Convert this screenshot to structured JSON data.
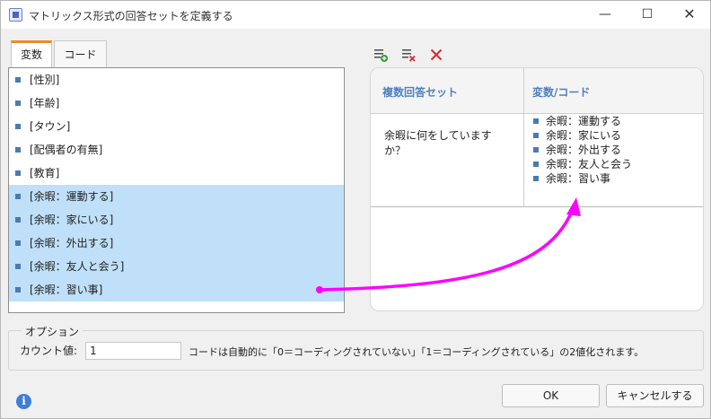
{
  "window": {
    "title": "マトリックス形式の回答セットを定義する",
    "minimize_glyph": "—",
    "maximize_glyph": "☐",
    "close_glyph": "✕"
  },
  "tabs": [
    {
      "label": "変数",
      "active": true
    },
    {
      "label": "コード",
      "active": false
    }
  ],
  "variables": [
    {
      "label": "[性別]",
      "selected": false
    },
    {
      "label": "[年齢]",
      "selected": false
    },
    {
      "label": "[タウン]",
      "selected": false
    },
    {
      "label": "[配偶者の有無]",
      "selected": false
    },
    {
      "label": "[教育]",
      "selected": false
    },
    {
      "label": "[余暇：運動する]",
      "selected": true
    },
    {
      "label": "[余暇：家にいる]",
      "selected": true
    },
    {
      "label": "[余暇：外出する]",
      "selected": true
    },
    {
      "label": "[余暇：友人と会う]",
      "selected": true
    },
    {
      "label": "[余暇：習い事]",
      "selected": true
    }
  ],
  "toolbar": {
    "icons": [
      "add-set-icon",
      "remove-set-icon",
      "delete-icon"
    ],
    "accent_green": "#3a9a3a",
    "accent_red": "#d62b2b"
  },
  "grid": {
    "col1_header": "複数回答セット",
    "col2_header": "変数/コード",
    "question": "余暇に何をしていますか？",
    "items": [
      "余暇：運動する",
      "余暇：家にいる",
      "余暇：外出する",
      "余暇：友人と会う",
      "余暇：習い事"
    ]
  },
  "options": {
    "group_label": "オプション",
    "count_label": "カウント値:",
    "count_value": "1",
    "note": "コードは自動的に「0＝コーディングされていない」「1＝コーディングされている」の2値化されます。"
  },
  "buttons": {
    "ok": "OK",
    "cancel": "キャンセルする"
  },
  "colors": {
    "selection": "#bfe0f8",
    "tab_accent": "#e88d2d",
    "header_text": "#4f7fbf",
    "arrow": "#ff00ff",
    "info": "#3d7fd6"
  }
}
